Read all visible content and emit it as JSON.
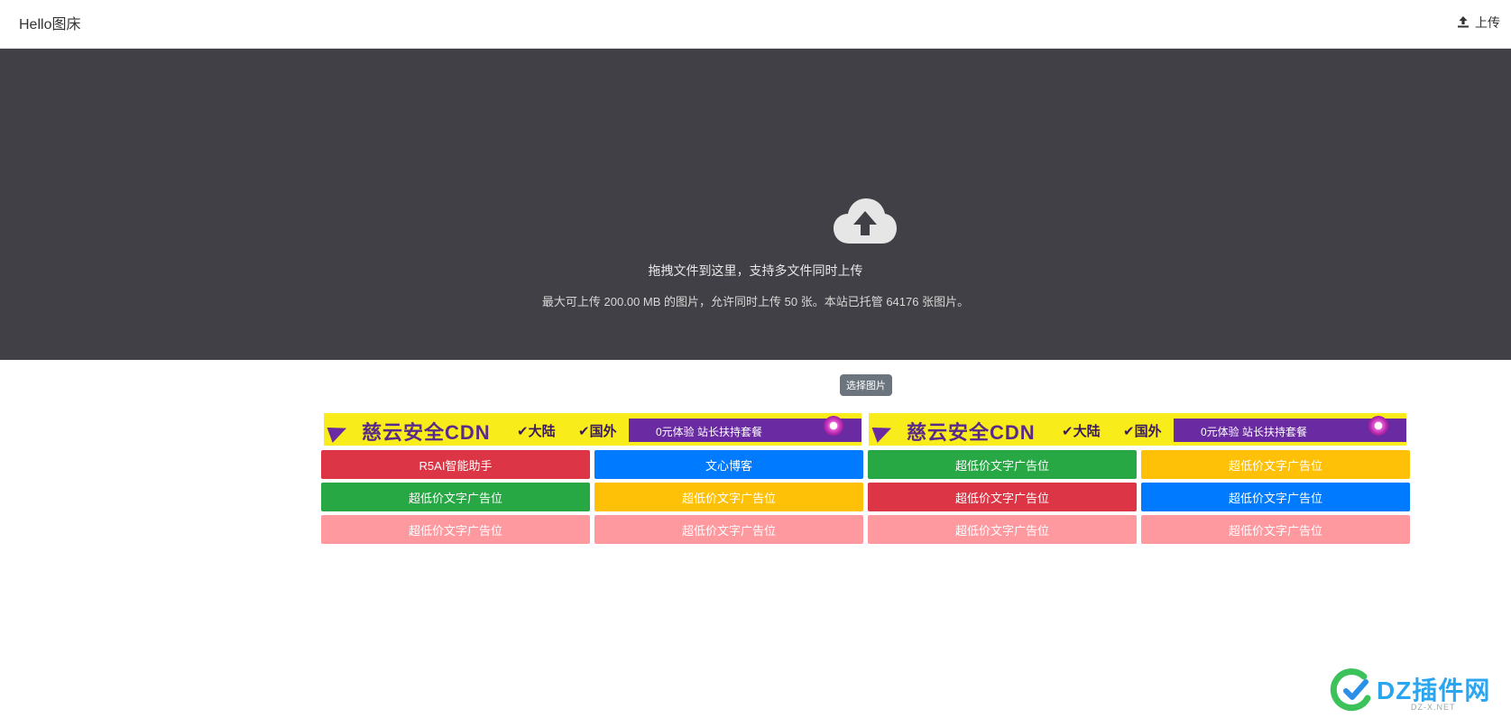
{
  "header": {
    "brand": "Hello图床",
    "upload_label": "上传"
  },
  "dropzone": {
    "line1": "拖拽文件到这里，支持多文件同时上传",
    "line2": "最大可上传 200.00 MB 的图片，允许同时上传 50 张。本站已托管 64176 张图片。"
  },
  "choose_button": "选择图片",
  "banners": [
    {
      "title": "慈云安全CDN",
      "tag1": "✔大陆",
      "tag2": "✔国外",
      "offer": "0元体验   站长扶持套餐"
    },
    {
      "title": "慈云安全CDN",
      "tag1": "✔大陆",
      "tag2": "✔国外",
      "offer": "0元体验   站长扶持套餐"
    }
  ],
  "ads": [
    {
      "label": "R5AI智能助手",
      "color": "red"
    },
    {
      "label": "文心博客",
      "color": "blue"
    },
    {
      "label": "超低价文字广告位",
      "color": "green"
    },
    {
      "label": "超低价文字广告位",
      "color": "yellow"
    },
    {
      "label": "超低价文字广告位",
      "color": "green"
    },
    {
      "label": "超低价文字广告位",
      "color": "yellow"
    },
    {
      "label": "超低价文字广告位",
      "color": "red"
    },
    {
      "label": "超低价文字广告位",
      "color": "blue"
    },
    {
      "label": "超低价文字广告位",
      "color": "pink"
    },
    {
      "label": "超低价文字广告位",
      "color": "pink"
    },
    {
      "label": "超低价文字广告位",
      "color": "pink"
    },
    {
      "label": "超低价文字广告位",
      "color": "pink"
    }
  ],
  "watermark": {
    "text": "DZ插件网",
    "sub": "DZ-X.NET"
  },
  "colors": {
    "dropzone_bg": "#404046",
    "red": "#dc3545",
    "blue": "#007bff",
    "green": "#28a745",
    "yellow": "#ffc107",
    "pink": "#ff99a0",
    "banner_yellow": "#f8ec1a",
    "banner_purple": "#6a2aa2"
  },
  "icons": {
    "upload": "upload-icon",
    "cloud": "cloud-upload-icon"
  }
}
